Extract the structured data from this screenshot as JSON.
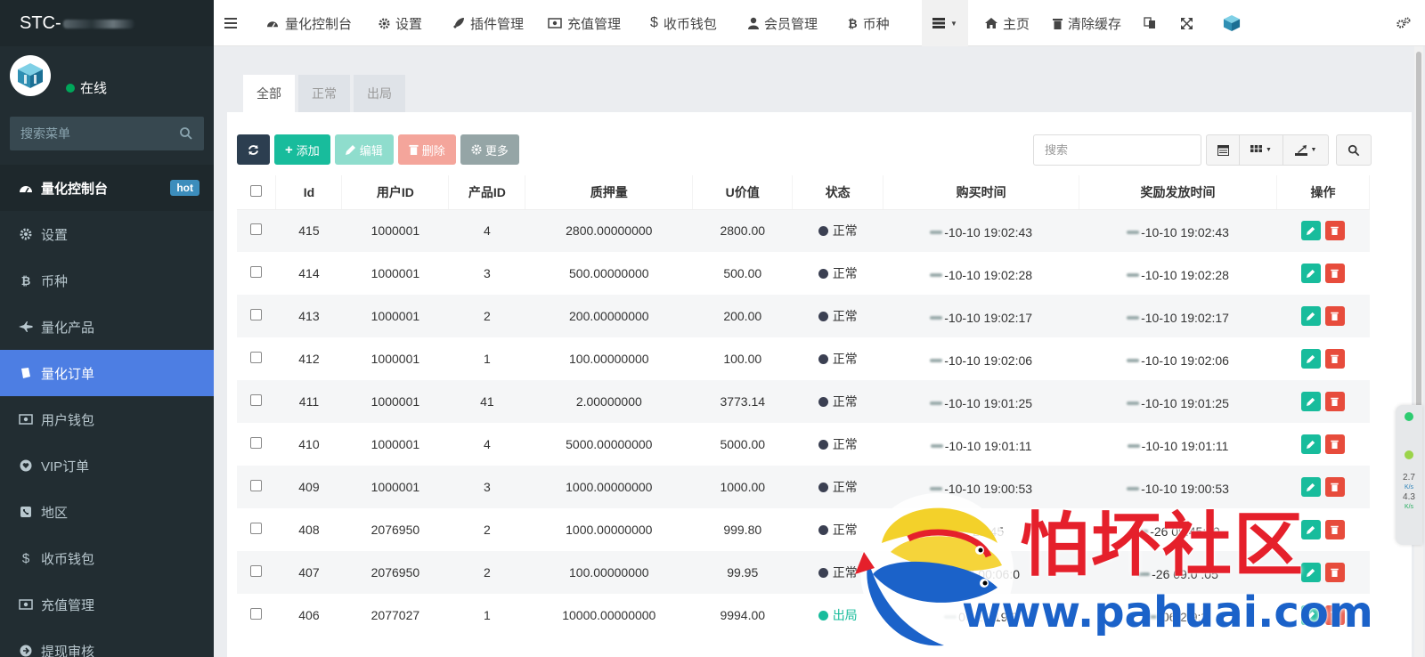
{
  "brand": {
    "title": "STC-"
  },
  "user": {
    "status": "在线"
  },
  "sidebar": {
    "search_placeholder": "搜索菜单",
    "items": [
      {
        "label": "量化控制台",
        "badge": "hot"
      },
      {
        "label": "设置"
      },
      {
        "label": "币种"
      },
      {
        "label": "量化产品"
      },
      {
        "label": "量化订单"
      },
      {
        "label": "用户钱包"
      },
      {
        "label": "VIP订单"
      },
      {
        "label": "地区"
      },
      {
        "label": "收币钱包"
      },
      {
        "label": "充值管理"
      },
      {
        "label": "提现审核"
      }
    ]
  },
  "topbar": {
    "items": [
      "量化控制台",
      "设置",
      "插件管理",
      "充值管理",
      "收币钱包",
      "会员管理",
      "币种"
    ],
    "home": "主页",
    "clear_cache": "清除缓存"
  },
  "tabs": [
    "全部",
    "正常",
    "出局"
  ],
  "toolbar": {
    "add": "添加",
    "edit": "编辑",
    "delete": "删除",
    "more": "更多",
    "search_placeholder": "搜索"
  },
  "table": {
    "headers": [
      "Id",
      "用户ID",
      "产品ID",
      "质押量",
      "U价值",
      "状态",
      "购买时间",
      "奖励发放时间",
      "操作"
    ],
    "rows": [
      {
        "id": "415",
        "user": "1000001",
        "product": "4",
        "amount": "2800.00000000",
        "value": "2800.00",
        "status": "正常",
        "buy": "-10-10 19:02:43",
        "reward": "-10-10 19:02:43"
      },
      {
        "id": "414",
        "user": "1000001",
        "product": "3",
        "amount": "500.00000000",
        "value": "500.00",
        "status": "正常",
        "buy": "-10-10 19:02:28",
        "reward": "-10-10 19:02:28"
      },
      {
        "id": "413",
        "user": "1000001",
        "product": "2",
        "amount": "200.00000000",
        "value": "200.00",
        "status": "正常",
        "buy": "-10-10 19:02:17",
        "reward": "-10-10 19:02:17"
      },
      {
        "id": "412",
        "user": "1000001",
        "product": "1",
        "amount": "100.00000000",
        "value": "100.00",
        "status": "正常",
        "buy": "-10-10 19:02:06",
        "reward": "-10-10 19:02:06"
      },
      {
        "id": "411",
        "user": "1000001",
        "product": "41",
        "amount": "2.00000000",
        "value": "3773.14",
        "status": "正常",
        "buy": "-10-10 19:01:25",
        "reward": "-10-10 19:01:25"
      },
      {
        "id": "410",
        "user": "1000001",
        "product": "4",
        "amount": "5000.00000000",
        "value": "5000.00",
        "status": "正常",
        "buy": "-10-10 19:01:11",
        "reward": "-10-10 19:01:11"
      },
      {
        "id": "409",
        "user": "1000001",
        "product": "3",
        "amount": "1000.00000000",
        "value": "1000.00",
        "status": "正常",
        "buy": "-10-10 19:00:53",
        "reward": "-10-10 19:00:53"
      },
      {
        "id": "408",
        "user": "2076950",
        "product": "2",
        "amount": "1000.00000000",
        "value": "999.80",
        "status": "正常",
        "buy": "22:45",
        "reward": "-26 09:45:39"
      },
      {
        "id": "407",
        "user": "2076950",
        "product": "2",
        "amount": "100.00000000",
        "value": "99.95",
        "status": "正常",
        "buy": "-16 00:06:0",
        "reward": "-26 09:0 :05"
      },
      {
        "id": "406",
        "user": "2077027",
        "product": "1",
        "amount": "10000.00000000",
        "value": "9994.00",
        "status": "出局",
        "buy": "06-26 19:3",
        "reward": "06-2 9:3"
      }
    ]
  },
  "widget": {
    "v1": "2.7",
    "u1": "K/s",
    "v2": "4.3",
    "u2": "K/s"
  },
  "watermark": {
    "title": "怕坏社区",
    "url": "www.pahuai.com"
  },
  "colors": {
    "sidebar": "#222d32",
    "active": "#4d7ee3",
    "green": "#18bc9c",
    "red": "#e74c3c",
    "dark": "#2c3e50"
  }
}
